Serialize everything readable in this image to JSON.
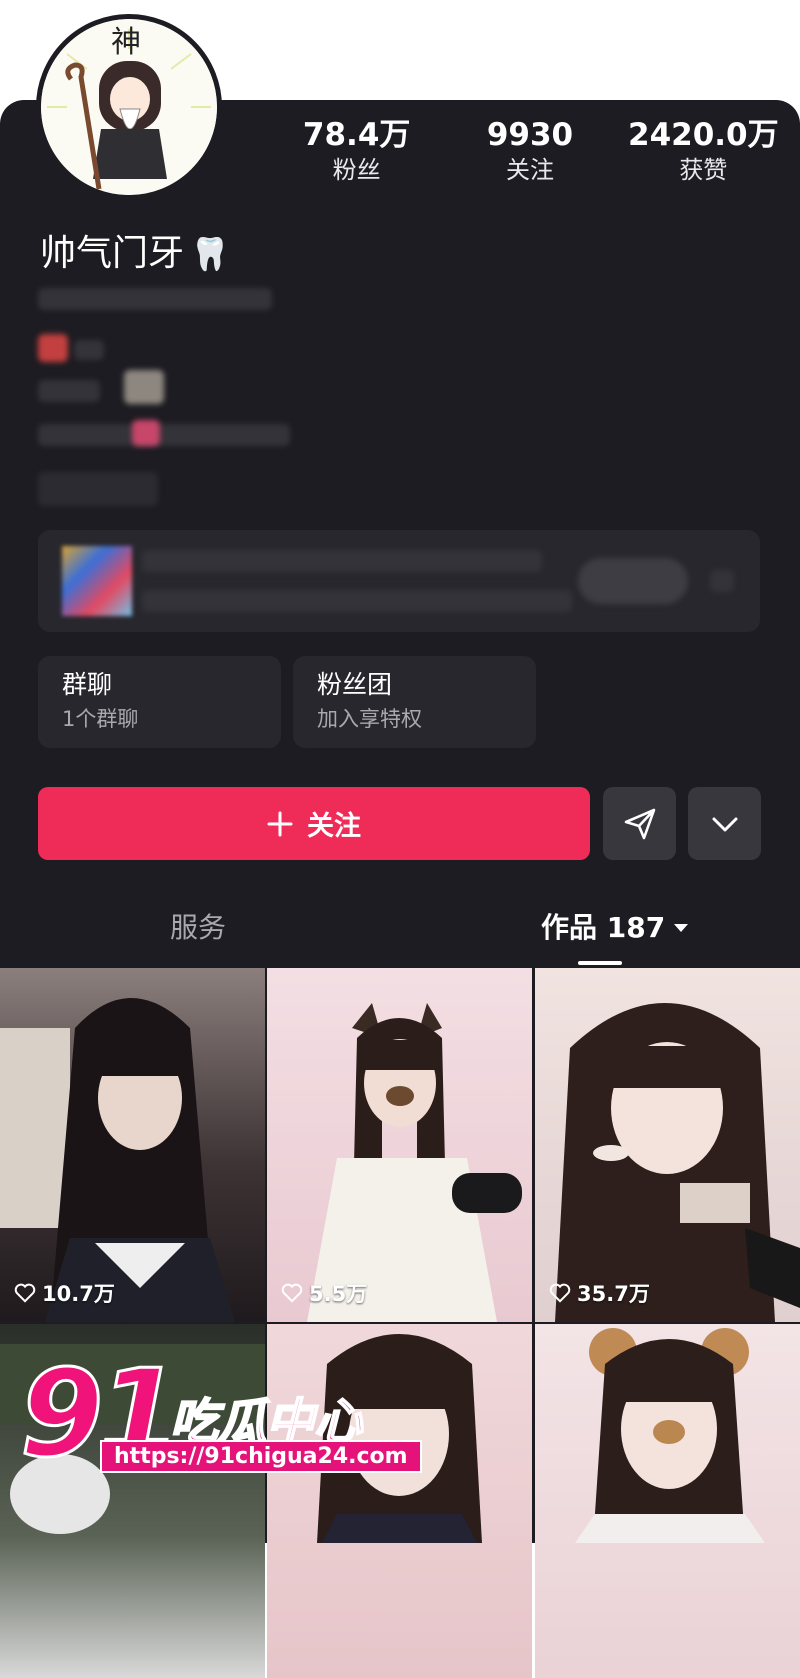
{
  "profile": {
    "avatar_text": "神",
    "nickname": "帅气门牙",
    "nickname_emoji": "🦷"
  },
  "stats": [
    {
      "value": "78.4万",
      "label": "粉丝"
    },
    {
      "value": "9930",
      "label": "关注"
    },
    {
      "value": "2420.0万",
      "label": "获赞"
    }
  ],
  "tiles": [
    {
      "title": "群聊",
      "subtitle": "1个群聊"
    },
    {
      "title": "粉丝团",
      "subtitle": "加入享特权"
    }
  ],
  "actions": {
    "follow_label": "关注",
    "follow_icon": "plus-icon",
    "share_icon": "send-icon",
    "more_icon": "chevron-down-icon"
  },
  "tabs": [
    {
      "label": "服务"
    },
    {
      "label": "作品 187",
      "active": true
    }
  ],
  "videos": [
    {
      "likes": "10.7万"
    },
    {
      "likes": "5.5万"
    },
    {
      "likes": "35.7万"
    },
    {
      "likes": ""
    },
    {
      "likes": ""
    },
    {
      "likes": ""
    }
  ],
  "watermark": {
    "number": "91",
    "text": "吃瓜中心",
    "url": "https://91chigua24.com"
  },
  "colors": {
    "accent": "#ef2c58",
    "background": "#1d1c22",
    "watermark": "#f0147a"
  }
}
